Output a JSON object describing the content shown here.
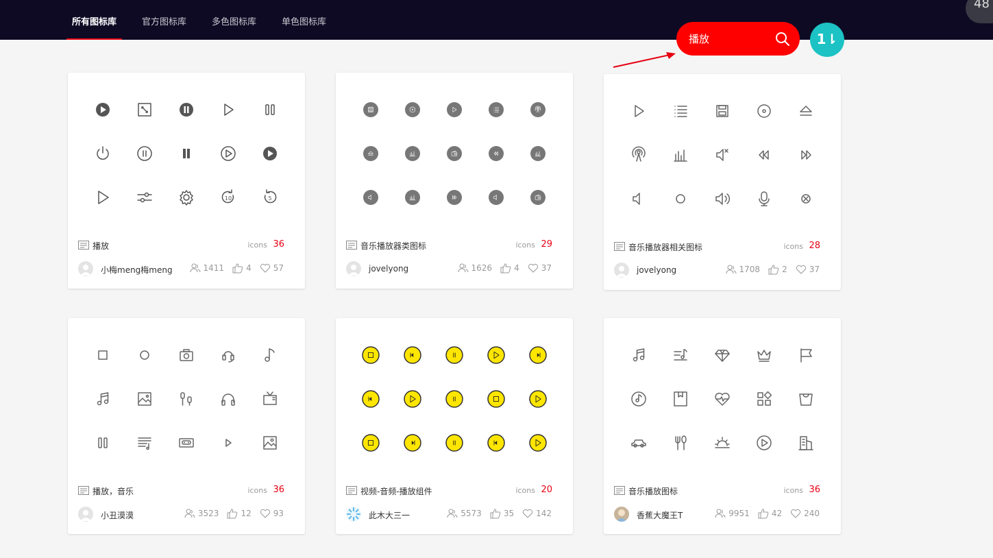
{
  "nav": {
    "tabs": [
      {
        "label": "所有图标库",
        "active": true
      },
      {
        "label": "官方图标库",
        "active": false
      },
      {
        "label": "多色图标库",
        "active": false
      },
      {
        "label": "单色图标库",
        "active": false
      }
    ]
  },
  "corner_badge": "48",
  "search": {
    "value": "播放",
    "icon": "search-icon"
  },
  "sort_button": {
    "label": "1⇂"
  },
  "labels": {
    "icons": "icons"
  },
  "colors": {
    "accent": "#e60012",
    "search_bg": "#ff0000",
    "sort_bg": "#1cc2c4",
    "nav_bg": "#0e0a24",
    "yellow": "#ffe600"
  },
  "cards": [
    {
      "title": "播放",
      "count": "36",
      "author": "小梅meng梅meng",
      "views": "1411",
      "likes": "4",
      "favorites": "57",
      "style": "dark-outline",
      "icons": [
        "play-circle-icon",
        "expand-icon",
        "pause-circle-icon",
        "play-icon",
        "pause-outline-icon",
        "power-icon",
        "pause-ring-icon",
        "pause-bars-icon",
        "play-ring-icon",
        "play-circle-filled-icon",
        "play-outline-icon",
        "sliders-icon",
        "settings-icon",
        "forward-10-icon",
        "replay-5-icon"
      ]
    },
    {
      "title": "音乐播放器类图标",
      "count": "29",
      "author": "jovelyong",
      "views": "1626",
      "likes": "4",
      "favorites": "37",
      "style": "gray-circle",
      "icons": [
        "save-icon",
        "disc-icon",
        "play-icon",
        "list-icon",
        "broadcast-icon",
        "eject-icon",
        "equalizer-icon",
        "radio-icon",
        "rewind-icon",
        "equalizer-icon",
        "volume-icon",
        "equalizer-icon",
        "fast-forward-icon",
        "volume-icon",
        "radio-icon"
      ]
    },
    {
      "title": "音乐播放器相关图标",
      "count": "28",
      "author": "jovelyong",
      "views": "1708",
      "likes": "2",
      "favorites": "37",
      "style": "thin-line",
      "icons": [
        "play-icon",
        "list-icon",
        "save-icon",
        "disc-icon",
        "eject-icon",
        "broadcast-icon",
        "equalizer-icon",
        "mute-icon",
        "rewind-icon",
        "fast-forward-icon",
        "volume-low-icon",
        "circle-icon",
        "volume-high-icon",
        "microphone-icon",
        "close-circle-icon"
      ]
    },
    {
      "title": "播放，音乐",
      "count": "36",
      "author": "小丑漠漠",
      "views": "3523",
      "likes": "12",
      "favorites": "93",
      "style": "thin-line",
      "icons": [
        "stop-icon",
        "circle-icon",
        "camera-icon",
        "headset-icon",
        "music-note-icon",
        "music-notes-icon",
        "picture-icon",
        "earphones-icon",
        "headphones-icon",
        "tv-icon",
        "pause-outline-icon",
        "playlist-icon",
        "cassette-icon",
        "play-small-icon",
        "image-icon"
      ]
    },
    {
      "title": "视频-音频-播放组件",
      "count": "20",
      "author": "此木大三一",
      "views": "5573",
      "likes": "35",
      "favorites": "142",
      "style": "yellow-circle",
      "icons": [
        "stop-icon",
        "prev-icon",
        "pause-icon",
        "play-icon",
        "next-icon",
        "prev-icon",
        "play-icon",
        "pause-icon",
        "stop-icon",
        "play-icon",
        "stop-icon",
        "next-icon",
        "pause-icon",
        "prev-icon",
        "play-icon"
      ]
    },
    {
      "title": "音乐播放图标",
      "count": "36",
      "author": "香蕉大魔王T",
      "views": "9951",
      "likes": "42",
      "favorites": "240",
      "style": "thin-line",
      "icons": [
        "music-notes-icon",
        "music-list-icon",
        "diamond-icon",
        "crown-icon",
        "flag-icon",
        "disc-note-icon",
        "bookmark-icon",
        "heart-pulse-icon",
        "apps-icon",
        "bag-icon",
        "car-icon",
        "fork-spoon-icon",
        "sunrise-icon",
        "play-ring-icon",
        "building-icon"
      ]
    }
  ]
}
